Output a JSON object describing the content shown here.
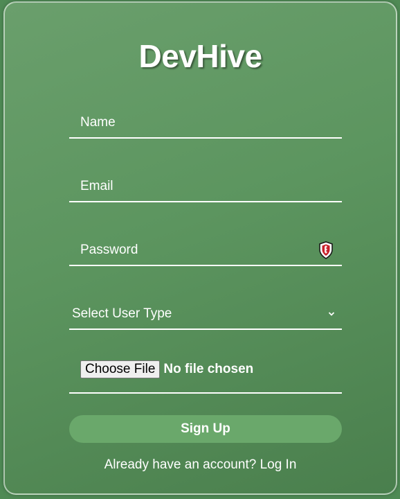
{
  "app": {
    "title": "DevHive"
  },
  "form": {
    "name_placeholder": "Name",
    "email_placeholder": "Email",
    "password_placeholder": "Password",
    "user_type_label": "Select User Type",
    "file_button_label": "Choose File",
    "file_status": "No file chosen",
    "submit_label": "Sign Up"
  },
  "footer": {
    "prompt": "Already have an account?",
    "login_link": "Log In"
  },
  "icons": {
    "password_manager": "password-manager-shield-icon",
    "select_chevron": "chevron-down-icon"
  },
  "colors": {
    "background": "#4f8a55",
    "button": "#6aa86b",
    "text": "#ffffff"
  }
}
